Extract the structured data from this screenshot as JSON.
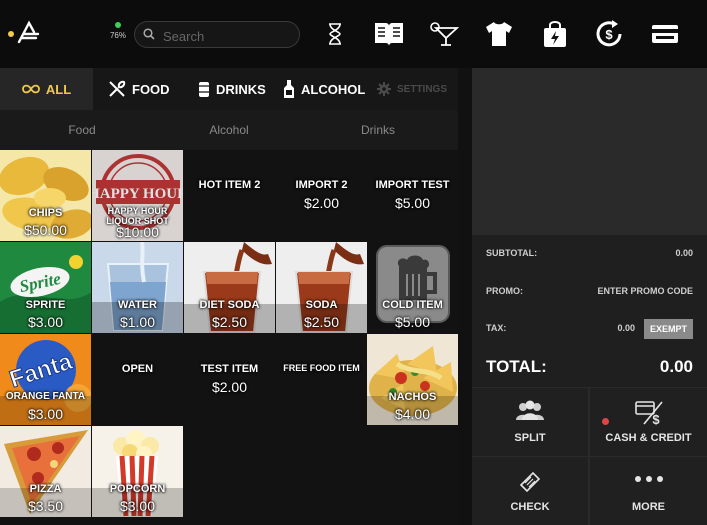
{
  "topbar": {
    "battery": "76%",
    "search_placeholder": "Search",
    "icons": [
      "hourglass-icon",
      "menu-book-icon",
      "cocktail-icon",
      "tshirt-icon",
      "shopping-bag-icon",
      "refresh-money-icon",
      "credit-card-icon"
    ]
  },
  "tabs": [
    {
      "label": "ALL",
      "icon": "infinity-icon",
      "active": true
    },
    {
      "label": "FOOD",
      "icon": "utensils-icon"
    },
    {
      "label": "DRINKS",
      "icon": "can-icon"
    },
    {
      "label": "ALCOHOL",
      "icon": "bottle-icon"
    },
    {
      "label": "SETTINGS",
      "icon": "gear-icon",
      "disabled": true
    }
  ],
  "subtabs": [
    "Food",
    "Alcohol",
    "Drinks"
  ],
  "items": [
    {
      "name": "CHIPS",
      "price": "$50.00",
      "image": "chips"
    },
    {
      "name": "HAPPY HOUR LIQUOR SHOT",
      "price": "$10.00",
      "image": "happy-hour",
      "stamp": "HAPPY HOUR"
    },
    {
      "name": "HOT ITEM 2",
      "price": ""
    },
    {
      "name": "IMPORT 2",
      "price": "$2.00"
    },
    {
      "name": "IMPORT TEST",
      "price": "$5.00"
    },
    {
      "name": "SPRITE",
      "price": "$3.00",
      "image": "sprite",
      "brand": "Sprite"
    },
    {
      "name": "WATER",
      "price": "$1.00",
      "image": "water"
    },
    {
      "name": "DIET SODA",
      "price": "$2.50",
      "image": "soda"
    },
    {
      "name": "SODA",
      "price": "$2.50",
      "image": "soda"
    },
    {
      "name": "COLD ITEM",
      "price": "$5.00",
      "image": "cold"
    },
    {
      "name": "ORANGE FANTA",
      "price": "$3.00",
      "image": "fanta",
      "brand": "Fanta"
    },
    {
      "name": "OPEN",
      "price": ""
    },
    {
      "name": "TEST ITEM",
      "price": "$2.00"
    },
    {
      "name": "FREE FOOD ITEM",
      "price": ""
    },
    {
      "name": "NACHOS",
      "price": "$4.00",
      "image": "nachos"
    },
    {
      "name": "PIZZA",
      "price": "$3.50",
      "image": "pizza"
    },
    {
      "name": "POPCORN",
      "price": "$3.00",
      "image": "popcorn"
    }
  ],
  "summary": {
    "subtotal_label": "SUBTOTAL:",
    "subtotal_value": "0.00",
    "promo_label": "PROMO:",
    "promo_value": "ENTER PROMO CODE",
    "tax_label": "TAX:",
    "tax_value": "0.00",
    "exempt_label": "EXEMPT",
    "total_label": "TOTAL:",
    "total_value": "0.00"
  },
  "actions": [
    {
      "label": "SPLIT",
      "icon": "people-icon"
    },
    {
      "label": "CASH & CREDIT",
      "icon": "cash-credit-icon"
    },
    {
      "label": "CHECK",
      "icon": "ticket-icon"
    },
    {
      "label": "MORE",
      "icon": "dots-icon"
    }
  ],
  "colors": {
    "accent": "#f2c94c",
    "background": "#121212",
    "panel": "#2a2a2a",
    "alert": "#e04545"
  }
}
